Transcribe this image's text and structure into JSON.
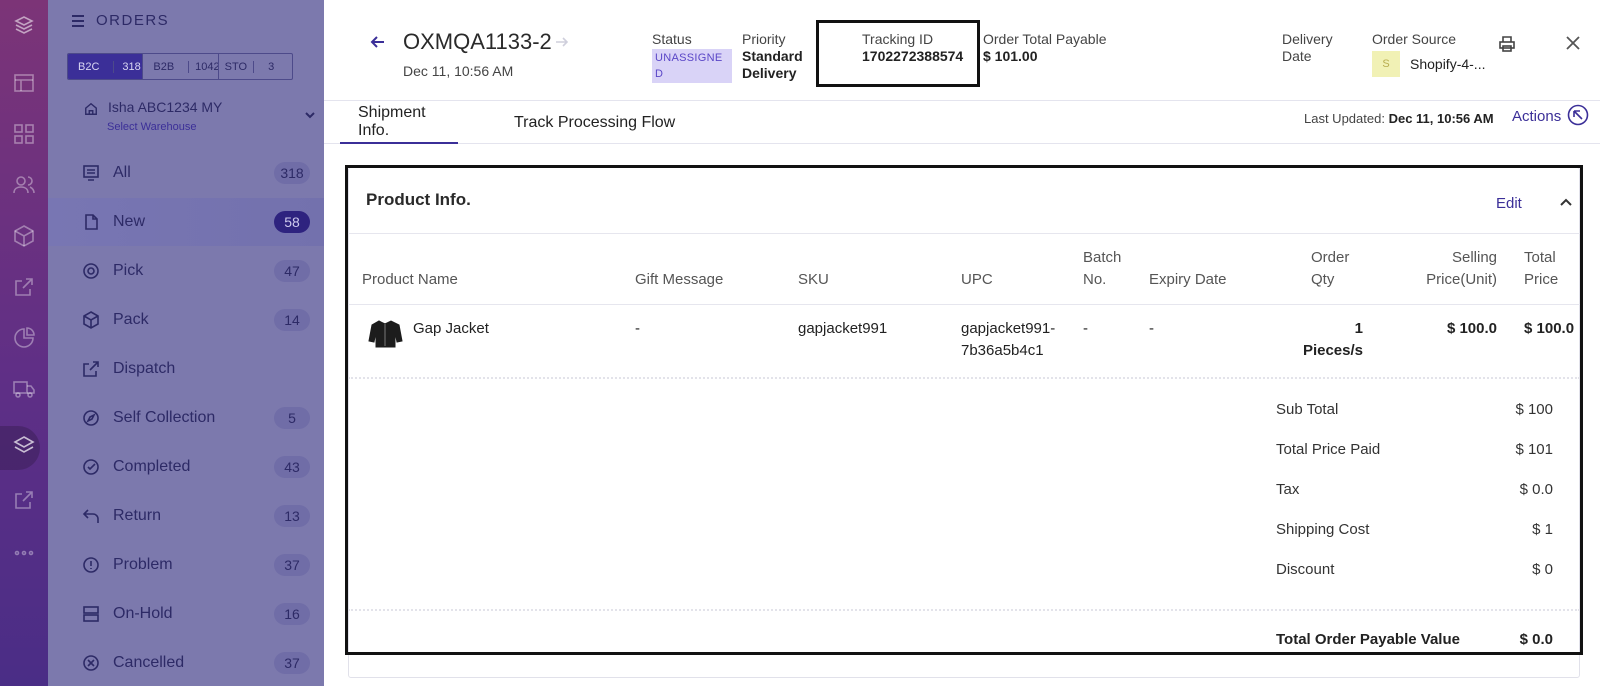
{
  "rail": {
    "icons": [
      "logo-icon",
      "store-icon",
      "dashboard-icon",
      "users-icon",
      "box-icon",
      "external-link-icon",
      "pie-chart-icon",
      "truck-icon",
      "layers-icon",
      "share-icon",
      "more-icon"
    ]
  },
  "sidebar": {
    "title": "ORDERS",
    "segments": [
      {
        "label": "B2C",
        "count": "318"
      },
      {
        "label": "B2B",
        "count": "1042"
      },
      {
        "label": "STO",
        "count": "3"
      }
    ],
    "warehouse": {
      "name": "Isha ABC1234 MY",
      "select_label": "Select Warehouse"
    },
    "items": [
      {
        "label": "All",
        "count": "318"
      },
      {
        "label": "New",
        "count": "58"
      },
      {
        "label": "Pick",
        "count": "47"
      },
      {
        "label": "Pack",
        "count": "14"
      },
      {
        "label": "Dispatch",
        "count": ""
      },
      {
        "label": "Self Collection",
        "count": "5"
      },
      {
        "label": "Completed",
        "count": "43"
      },
      {
        "label": "Return",
        "count": "13"
      },
      {
        "label": "Problem",
        "count": "37"
      },
      {
        "label": "On-Hold",
        "count": "16"
      },
      {
        "label": "Cancelled",
        "count": "37"
      }
    ]
  },
  "order": {
    "id": "OXMQA1133-2",
    "date": "Dec 11, 10:56 AM",
    "status_label": "Status",
    "status_value": "UNASSIGNED",
    "priority_label": "Priority",
    "priority_value_line1": "Standard",
    "priority_value_line2": "Delivery",
    "tracking_label": "Tracking ID",
    "tracking_value": "1702272388574",
    "total_label": "Order Total Payable",
    "total_value": "$ 101.00",
    "delivery_label_line1": "Delivery",
    "delivery_label_line2": "Date",
    "source_label": "Order Source",
    "source_icon": "S",
    "source_value": "Shopify-4-..."
  },
  "tabs": [
    {
      "label": "Shipment Info."
    },
    {
      "label": "Track Processing Flow"
    }
  ],
  "last_updated": {
    "label": "Last Updated:",
    "value": "Dec 11, 10:56 AM"
  },
  "actions_label": "Actions",
  "product_info": {
    "title": "Product Info.",
    "edit_label": "Edit",
    "columns": {
      "product_name": "Product Name",
      "gift_message": "Gift Message",
      "sku": "SKU",
      "upc": "UPC",
      "batch_no_1": "Batch",
      "batch_no_2": "No.",
      "expiry_date": "Expiry Date",
      "order_qty_1": "Order",
      "order_qty_2": "Qty",
      "selling_price_1": "Selling",
      "selling_price_2": "Price(Unit)",
      "total_price_1": "Total",
      "total_price_2": "Price"
    },
    "rows": [
      {
        "product_name": "Gap Jacket",
        "gift_message": "-",
        "sku": "gapjacket991",
        "upc_1": "gapjacket991-",
        "upc_2": "7b36a5b4c1",
        "batch_no": "-",
        "expiry_date": "-",
        "qty_1": "1",
        "qty_2": "Pieces/s",
        "selling_price": "$ 100.0",
        "total_price": "$ 100.0"
      }
    ],
    "summary": [
      {
        "label": "Sub Total",
        "value": "$ 100"
      },
      {
        "label": "Total Price Paid",
        "value": "$ 101"
      },
      {
        "label": "Tax",
        "value": "$ 0.0"
      },
      {
        "label": "Shipping Cost",
        "value": "$ 1"
      },
      {
        "label": "Discount",
        "value": "$ 0"
      }
    ],
    "total_payable": {
      "label": "Total Order Payable Value",
      "value": "$ 0.0"
    }
  }
}
